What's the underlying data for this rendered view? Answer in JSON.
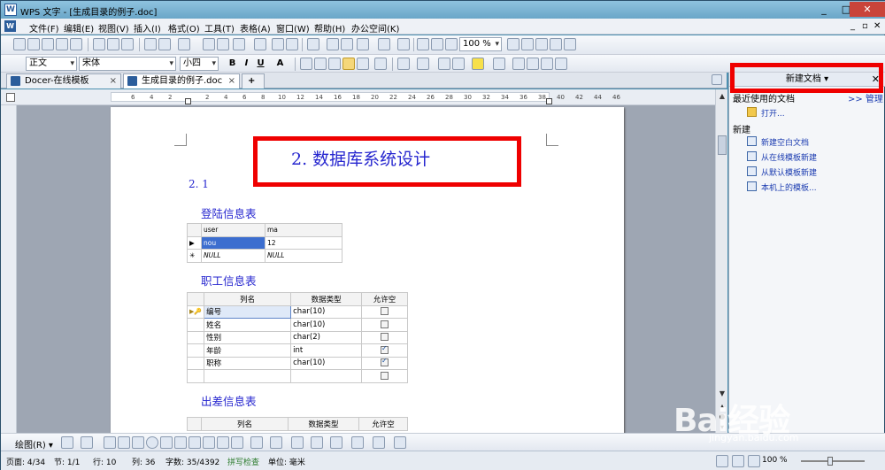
{
  "window": {
    "title": "WPS 文字 - [生成目录的例子.doc]",
    "controls": [
      "_",
      "□",
      "✕"
    ]
  },
  "menu": {
    "items": [
      "文件(F)",
      "编辑(E)",
      "视图(V)",
      "插入(I)",
      "格式(O)",
      "工具(T)",
      "表格(A)",
      "窗口(W)",
      "帮助(H)",
      "办公空间(K)"
    ],
    "doc_controls": [
      "_",
      "▫",
      "✕"
    ]
  },
  "toolbar": {
    "zoom": "100 %",
    "style": "正文",
    "font": "宋体",
    "size": "小四",
    "format_buttons": [
      "B",
      "I",
      "U",
      "A"
    ]
  },
  "tabs": [
    {
      "label": "Docer-在线模板",
      "close": "×"
    },
    {
      "label": "生成目录的例子.doc",
      "close": "×"
    }
  ],
  "ruler": {
    "labels": [
      "6",
      "4",
      "2",
      "2",
      "4",
      "6",
      "8",
      "10",
      "12",
      "14",
      "16",
      "18",
      "20",
      "22",
      "24",
      "26",
      "28",
      "30",
      "32",
      "34",
      "36",
      "38",
      "40",
      "42",
      "44",
      "46"
    ]
  },
  "document": {
    "heading": "2. 数据库系统设计",
    "subheading": "2. 1",
    "login_title": "登陆信息表",
    "login_table": {
      "headers": [
        "",
        "user",
        "ma"
      ],
      "rows": [
        {
          "marker": "▶",
          "user": "nou",
          "ma": "12"
        },
        {
          "marker": "✳",
          "user": "NULL",
          "ma": "NULL"
        }
      ]
    },
    "staff_title": "职工信息表",
    "staff_table": {
      "headers": [
        "",
        "列名",
        "数据类型",
        "允许空"
      ],
      "rows": [
        {
          "key": "▶🔑",
          "name": "编号",
          "type": "char(10)",
          "nullable": false
        },
        {
          "key": "",
          "name": "姓名",
          "type": "char(10)",
          "nullable": false
        },
        {
          "key": "",
          "name": "性别",
          "type": "char(2)",
          "nullable": false
        },
        {
          "key": "",
          "name": "年龄",
          "type": "int",
          "nullable": true
        },
        {
          "key": "",
          "name": "职称",
          "type": "char(10)",
          "nullable": true
        },
        {
          "key": "",
          "name": "",
          "type": "",
          "nullable": false
        }
      ]
    },
    "trip_title": "出差信息表",
    "trip_table": {
      "headers": [
        "",
        "列名",
        "数据类型",
        "允许空"
      ]
    }
  },
  "taskpane": {
    "title": "新建文档 ▾",
    "close": "✕",
    "recent_label": "最近使用的文档",
    "manage_link": ">> 管理",
    "open_link": "打开...",
    "new_label": "新建",
    "new_items": [
      "新建空白文档",
      "从在线模板新建",
      "从默认模板新建",
      "本机上的模板..."
    ]
  },
  "drawbar": {
    "label": "绘图(R) ▾"
  },
  "statusbar": {
    "page": "页面: 4/34",
    "section": "节: 1/1",
    "line": "行: 10",
    "column": "列: 36",
    "wordcount": "字数: 35/4392",
    "spellcheck": "拼写检查",
    "unit": "单位: 毫米",
    "zoom": "100 %"
  },
  "watermark": {
    "text": "Bai经验",
    "url": "jingyan.baidu.com"
  },
  "colors": {
    "highlight": "#ef0000",
    "heading": "#2626cf",
    "link": "#1a3bb0"
  }
}
